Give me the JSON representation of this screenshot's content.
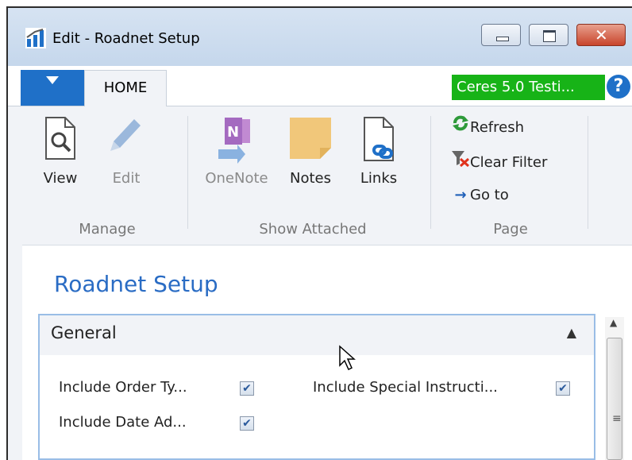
{
  "window": {
    "title": "Edit - Roadnet Setup"
  },
  "tabs": {
    "home_label": "HOME"
  },
  "company": {
    "label": "Ceres 5.0 Testi..."
  },
  "ribbon": {
    "manage": {
      "group_label": "Manage",
      "view_label": "View",
      "edit_label": "Edit"
    },
    "show_attached": {
      "group_label": "Show Attached",
      "onenote_label": "OneNote",
      "notes_label": "Notes",
      "links_label": "Links"
    },
    "page": {
      "group_label": "Page",
      "refresh_label": "Refresh",
      "clear_filter_label": "Clear Filter",
      "go_to_label": "Go to"
    }
  },
  "page": {
    "title": "Roadnet Setup"
  },
  "general": {
    "title": "General",
    "fields": [
      {
        "label": "Include Order Ty...",
        "checked": true
      },
      {
        "label": "Include Date Ad...",
        "checked": true
      },
      {
        "label": "Include Special Instructi...",
        "checked": true
      }
    ]
  },
  "colors": {
    "accent": "#2a6cc4",
    "company_badge": "#17b317",
    "file_tab": "#1f70c8"
  }
}
